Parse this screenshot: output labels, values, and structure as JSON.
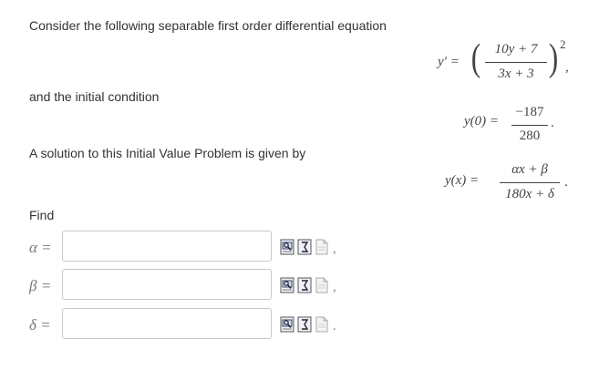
{
  "problem": {
    "intro": "Consider the following separable first order differential equation",
    "initial_text": "and the initial condition",
    "solution_text": "A solution to this Initial Value Problem is given by",
    "find_text": "Find"
  },
  "equation": {
    "lhs": "y′ =",
    "numerator": "10y + 7",
    "denominator": "3x + 3",
    "exponent": "2",
    "trailing": ","
  },
  "initial_condition": {
    "lhs": "y(0) =",
    "numerator": "−187",
    "denominator": "280",
    "trailing": "."
  },
  "solution": {
    "lhs": "y(x) =",
    "numerator": "αx + β",
    "denominator": "180x + δ",
    "trailing": "."
  },
  "answers": [
    {
      "label": "α =",
      "value": "",
      "trailing": ","
    },
    {
      "label": "β =",
      "value": "",
      "trailing": ","
    },
    {
      "label": "δ =",
      "value": "",
      "trailing": "."
    }
  ],
  "tool_icons": [
    "preview-icon",
    "equation-editor-icon",
    "file-icon"
  ]
}
